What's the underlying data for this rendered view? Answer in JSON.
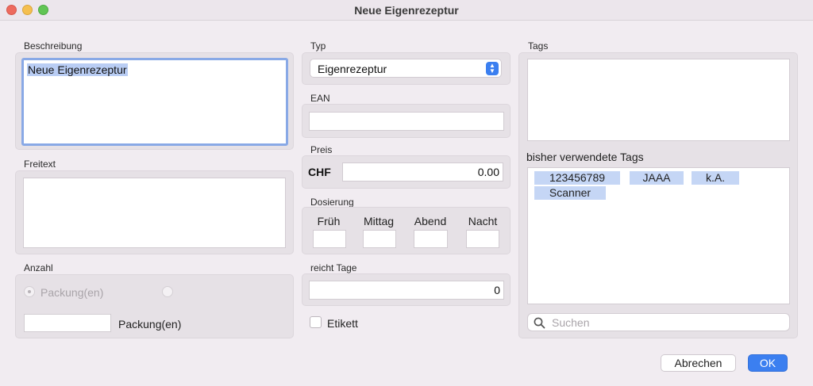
{
  "window": {
    "title": "Neue Eigenrezeptur",
    "controls": [
      "close",
      "minimize",
      "maximize"
    ]
  },
  "beschreibung": {
    "label": "Beschreibung",
    "value": "Neue Eigenrezeptur"
  },
  "freitext": {
    "label": "Freitext",
    "value": ""
  },
  "anzahl": {
    "label": "Anzahl",
    "radio1_label": "Packung(en)",
    "radio2_label": "",
    "quantity_value": "",
    "unit_label": "Packung(en)"
  },
  "typ": {
    "label": "Typ",
    "selected": "Eigenrezeptur"
  },
  "ean": {
    "label": "EAN",
    "value": ""
  },
  "preis": {
    "label": "Preis",
    "currency": "CHF",
    "value": "0.00"
  },
  "dosierung": {
    "label": "Dosierung",
    "columns": [
      "Früh",
      "Mittag",
      "Abend",
      "Nacht"
    ],
    "values": [
      "",
      "",
      "",
      ""
    ]
  },
  "reicht_tage": {
    "label": "reicht Tage",
    "value": "0"
  },
  "etikett": {
    "label": "Etikett",
    "checked": false
  },
  "tags": {
    "label": "Tags",
    "used_label": "bisher verwendete Tags",
    "used": [
      "123456789",
      "JAAA",
      "k.A.",
      "Scanner"
    ],
    "search_placeholder": "Suchen"
  },
  "buttons": {
    "cancel": "Abrechen",
    "ok": "OK"
  },
  "colors": {
    "accent": "#3b7ff0",
    "selection": "#b9cdf4",
    "tag_background": "#c5d6f5",
    "focus_ring": "#89a9e6",
    "window_background": "#f1ecf1"
  }
}
